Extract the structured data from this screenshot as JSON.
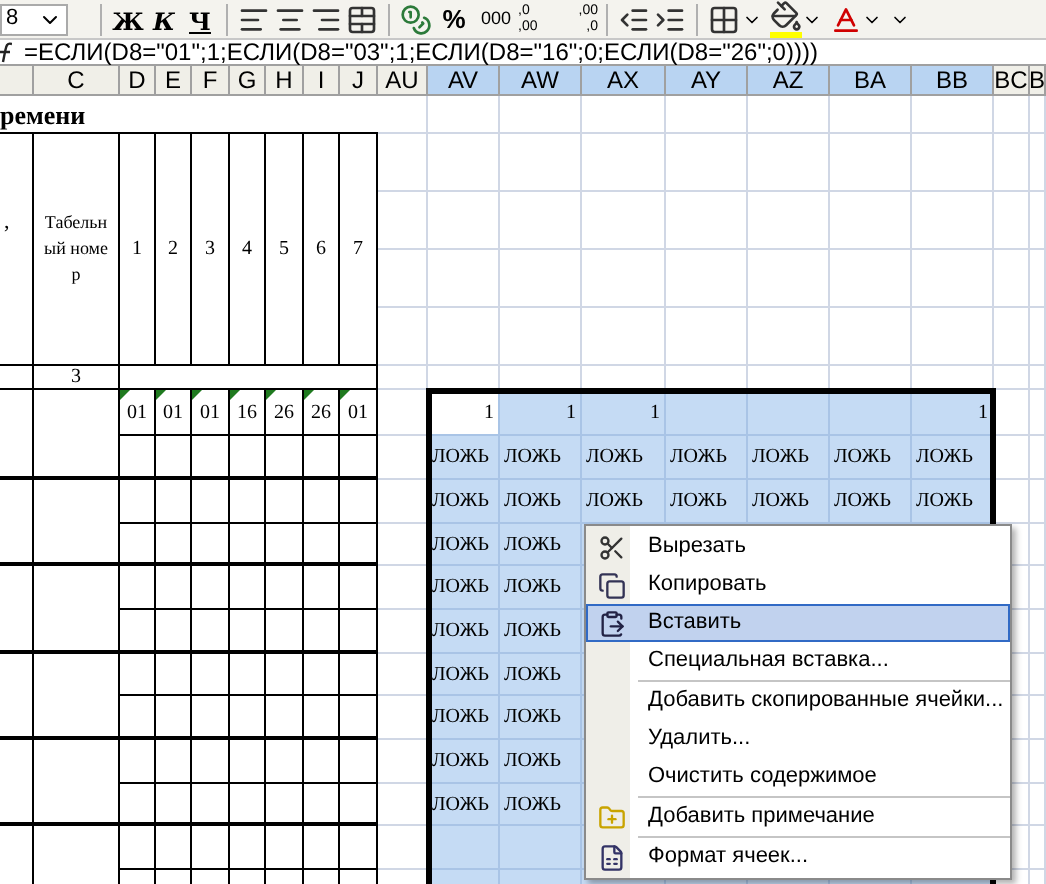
{
  "toolbar": {
    "font_size": "8",
    "style_buttons": [
      {
        "kind": "bold",
        "label": "Ж"
      },
      {
        "kind": "italic",
        "label": "К"
      },
      {
        "kind": "underline",
        "label": "Ч"
      }
    ],
    "percent": "%",
    "thousands": "000",
    "decimals": [
      {
        "kind": "increase",
        "top": ",0",
        "bottom": ",00"
      },
      {
        "kind": "decrease",
        "top": ",00",
        "bottom": ",0"
      }
    ]
  },
  "formula_bar": {
    "formula": "=ЕСЛИ(D8=\"01\";1;ЕСЛИ(D8=\"03\";1;ЕСЛИ(D8=\"16\";0;ЕСЛИ(D8=\"26\";0))))"
  },
  "columns": [
    {
      "label": "C",
      "selected": false
    },
    {
      "label": "D",
      "selected": false
    },
    {
      "label": "E",
      "selected": false
    },
    {
      "label": "F",
      "selected": false
    },
    {
      "label": "G",
      "selected": false
    },
    {
      "label": "H",
      "selected": false
    },
    {
      "label": "I",
      "selected": false
    },
    {
      "label": "J",
      "selected": false
    },
    {
      "label": "AU",
      "selected": false
    },
    {
      "label": "AV",
      "selected": true
    },
    {
      "label": "AW",
      "selected": true
    },
    {
      "label": "AX",
      "selected": true
    },
    {
      "label": "AY",
      "selected": true
    },
    {
      "label": "AZ",
      "selected": true
    },
    {
      "label": "BA",
      "selected": true
    },
    {
      "label": "BB",
      "selected": true
    },
    {
      "label": "BC",
      "selected": false
    },
    {
      "label": "B",
      "selected": false
    }
  ],
  "sheet": {
    "title": "ремени",
    "cut_header": ",",
    "id_header": "Табельный номер",
    "day_numbers": [
      "1",
      "2",
      "3",
      "4",
      "5",
      "6",
      "7"
    ],
    "column_number": "3",
    "codes": [
      {
        "text": "01",
        "flagged": true
      },
      {
        "text": "01",
        "flagged": true
      },
      {
        "text": "01",
        "flagged": true
      },
      {
        "text": "16",
        "flagged": true
      },
      {
        "text": "26",
        "flagged": true
      },
      {
        "text": "26",
        "flagged": true
      },
      {
        "text": "01",
        "flagged": true
      }
    ]
  },
  "selection": {
    "rows": [
      {
        "cells": [
          {
            "text": "1",
            "active": true
          },
          {
            "text": "1",
            "active": false
          },
          {
            "text": "1",
            "active": false
          },
          null,
          null,
          null,
          {
            "text": "1",
            "active": false
          }
        ]
      },
      {
        "cells": [
          {
            "text": "ЛОЖЬ",
            "active": false
          },
          {
            "text": "ЛОЖЬ",
            "active": false
          },
          {
            "text": "ЛОЖЬ",
            "active": false
          },
          {
            "text": "ЛОЖЬ",
            "active": false
          },
          {
            "text": "ЛОЖЬ",
            "active": false
          },
          {
            "text": "ЛОЖЬ",
            "active": false
          },
          {
            "text": "ЛОЖЬ",
            "active": false
          }
        ]
      },
      {
        "cells": [
          {
            "text": "ЛОЖЬ",
            "active": false
          },
          {
            "text": "ЛОЖЬ",
            "active": false
          },
          {
            "text": "ЛОЖЬ",
            "active": false
          },
          {
            "text": "ЛОЖЬ",
            "active": false
          },
          {
            "text": "ЛОЖЬ",
            "active": false
          },
          {
            "text": "ЛОЖЬ",
            "active": false
          },
          {
            "text": "ЛОЖЬ",
            "active": false
          }
        ]
      },
      {
        "cells": [
          {
            "text": "ЛОЖЬ",
            "active": false
          },
          {
            "text": "ЛОЖЬ",
            "active": false
          }
        ]
      },
      {
        "cells": [
          {
            "text": "ЛОЖЬ",
            "active": false
          },
          {
            "text": "ЛОЖЬ",
            "active": false
          }
        ]
      },
      {
        "cells": [
          {
            "text": "ЛОЖЬ",
            "active": false
          },
          {
            "text": "ЛОЖЬ",
            "active": false
          }
        ]
      },
      {
        "cells": [
          {
            "text": "ЛОЖЬ",
            "active": false
          },
          {
            "text": "ЛОЖЬ",
            "active": false
          }
        ]
      },
      {
        "cells": [
          {
            "text": "ЛОЖЬ",
            "active": false
          },
          {
            "text": "ЛОЖЬ",
            "active": false
          }
        ]
      },
      {
        "cells": [
          {
            "text": "ЛОЖЬ",
            "active": false
          },
          {
            "text": "ЛОЖЬ",
            "active": false
          }
        ]
      },
      {
        "cells": [
          {
            "text": "ЛОЖЬ",
            "active": false
          },
          {
            "text": "ЛОЖЬ",
            "active": false
          }
        ]
      }
    ]
  },
  "context_menu": {
    "items": [
      {
        "label": "Вырезать",
        "kind": "cut",
        "selected": false,
        "separator_before": false
      },
      {
        "label": "Копировать",
        "kind": "copy",
        "selected": false,
        "separator_before": false
      },
      {
        "label": "Вставить",
        "kind": "paste",
        "selected": true,
        "separator_before": false
      },
      {
        "label": "Специальная вставка...",
        "selected": false,
        "separator_before": false
      },
      {
        "label": "Добавить скопированные ячейки...",
        "selected": false,
        "separator_before": true
      },
      {
        "label": "Удалить...",
        "selected": false,
        "separator_before": false
      },
      {
        "label": "Очистить содержимое",
        "selected": false,
        "separator_before": false
      },
      {
        "label": "Добавить примечание",
        "kind": "comment",
        "selected": false,
        "separator_before": true
      },
      {
        "label": "Формат ячеек...",
        "kind": "format",
        "selected": false,
        "separator_before": true
      }
    ]
  }
}
